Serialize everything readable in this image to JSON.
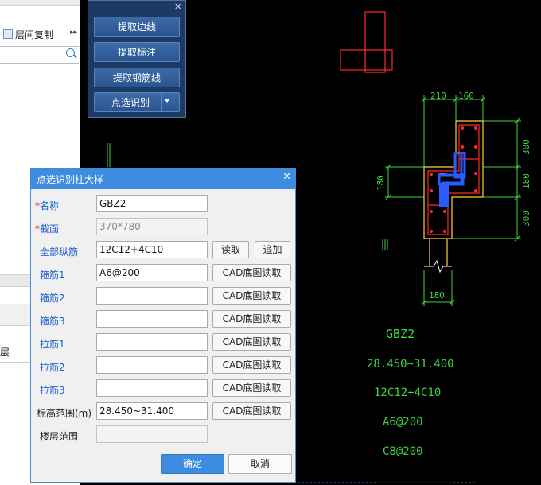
{
  "left_panel": {
    "copy_label": "层间复制",
    "floor_label": "层"
  },
  "tool_panel": {
    "buttons": [
      "提取边线",
      "提取标注",
      "提取钢筋线",
      "点选识别"
    ]
  },
  "dialog": {
    "title": "点选识别柱大样",
    "fields": {
      "name": {
        "label": "名称",
        "value": "GBZ2",
        "required": true
      },
      "section": {
        "label": "截面",
        "value": "370*780",
        "required": true
      },
      "all_long_bars": {
        "label": "全部纵筋",
        "value": "12C12+4C10"
      },
      "stirrup1": {
        "label": "箍筋1",
        "value": "A6@200"
      },
      "stirrup2": {
        "label": "箍筋2",
        "value": ""
      },
      "stirrup3": {
        "label": "箍筋3",
        "value": ""
      },
      "tie1": {
        "label": "拉筋1",
        "value": ""
      },
      "tie2": {
        "label": "拉筋2",
        "value": ""
      },
      "tie3": {
        "label": "拉筋3",
        "value": ""
      },
      "elevation": {
        "label": "标高范围(m)",
        "value": "28.450~31.400"
      },
      "floor_range": {
        "label": "楼层范围",
        "value": ""
      }
    },
    "read_label": "读取",
    "append_label": "追加",
    "cad_read_label": "CAD底图读取",
    "ok_label": "确定",
    "cancel_label": "取消"
  },
  "cad": {
    "dims": {
      "top_left": "210",
      "top_right": "160",
      "right_1": "300",
      "right_2": "180",
      "right_3": "300",
      "left": "180",
      "bottom": "180"
    },
    "labels": {
      "name": "GBZ2",
      "elevation": "28.450~31.400",
      "long_bars": "12C12+4C10",
      "stirrup": "A6@200",
      "tie": "C8@200"
    },
    "colors": {
      "red": "#ff2a2a",
      "green": "#3cd63c",
      "blue": "#2a5bff",
      "magenta": "#ff3cff",
      "yellow": "#ffd23a"
    }
  }
}
